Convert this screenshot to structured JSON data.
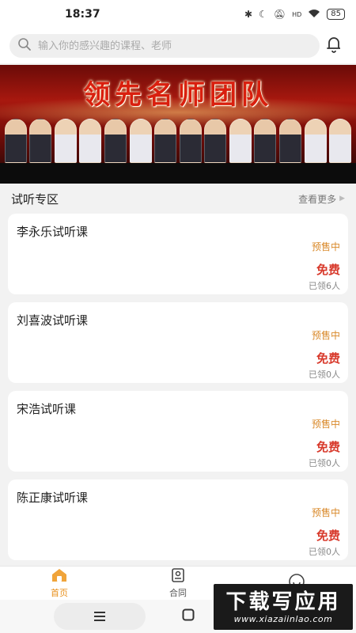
{
  "status_bar": {
    "time": "18:37",
    "network_label": "HD",
    "battery": "85"
  },
  "search": {
    "placeholder": "输入你的感兴趣的课程、老师"
  },
  "banner": {
    "title": "领先名师团队"
  },
  "trial_section": {
    "title": "试听专区",
    "more_label": "查看更多"
  },
  "courses": [
    {
      "title": "李永乐试听课",
      "status": "预售中",
      "price": "免费",
      "claimed": "已领6人"
    },
    {
      "title": "刘喜波试听课",
      "status": "预售中",
      "price": "免费",
      "claimed": "已领0人"
    },
    {
      "title": "宋浩试听课",
      "status": "预售中",
      "price": "免费",
      "claimed": "已领0人"
    },
    {
      "title": "陈正康试听课",
      "status": "预售中",
      "price": "免费",
      "claimed": "已领0人"
    }
  ],
  "tabbar": {
    "tabs": [
      {
        "label": "首页",
        "icon": "home-icon",
        "active": true
      },
      {
        "label": "合同",
        "icon": "contract-icon",
        "active": false
      },
      {
        "label": "",
        "icon": "smile-icon",
        "active": false
      }
    ]
  },
  "watermark": {
    "big": "下载写应用",
    "small": "www.xiazaiinlao.com"
  },
  "colors": {
    "accent": "#e8901c",
    "price": "#d83a2c",
    "status": "#d9892a"
  }
}
